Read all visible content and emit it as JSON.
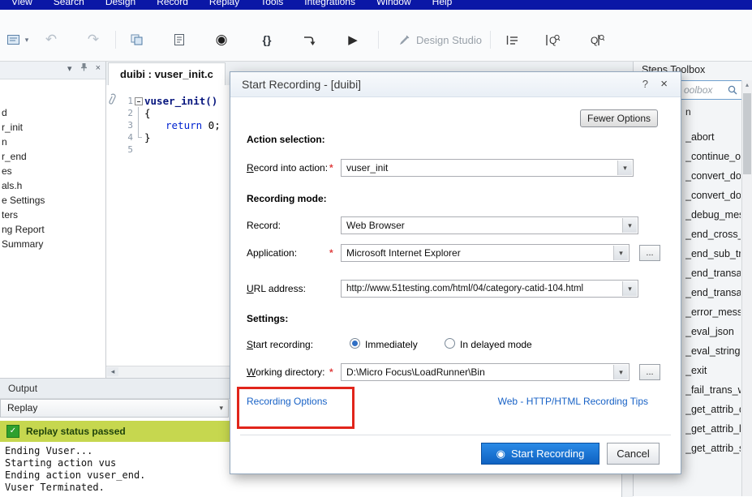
{
  "colors": {
    "menubar": "#0a17a6",
    "accent_blue": "#1173d2",
    "status_green_bg": "#c6d74f",
    "link_blue": "#1862c6",
    "annotation_red": "#e1251b"
  },
  "icons": {
    "caret_down": "▾",
    "undo": "↶",
    "redo": "↷",
    "record": "◉",
    "braces": "{}",
    "play": "▶",
    "close": "×",
    "check": "✓",
    "scroll_up": "▴",
    "scroll_left": "◂"
  },
  "menubar": {
    "items": [
      "View",
      "Search",
      "Design",
      "Record",
      "Replay",
      "Tools",
      "Integrations",
      "Window",
      "Help"
    ]
  },
  "toolbar": {
    "design_studio_label": "Design Studio"
  },
  "solution_panel": {
    "items": [
      "d",
      "r_init",
      "n",
      "r_end",
      "es",
      "als.h",
      "e Settings",
      "ters",
      "ng Report",
      "Summary"
    ]
  },
  "editor": {
    "tab_title": "duibi : vuser_init.c",
    "line_numbers": [
      "1",
      "2",
      "3",
      "4",
      "5"
    ],
    "code": {
      "line1": "vuser_init()",
      "line2": "{",
      "line3_keyword": "return",
      "line3_rest": " 0;",
      "line4": "}"
    }
  },
  "output": {
    "title": "Output",
    "filter_value": "Replay",
    "status_text": "Replay status passed",
    "console_lines": [
      "Ending Vuser...",
      "Starting action vus",
      "Ending action vuser_end.",
      "Vuser Terminated."
    ]
  },
  "steps_toolbox": {
    "title": "Steps Toolbox",
    "search_text": "oolbox",
    "category_label": "n",
    "items": [
      "_abort",
      "_continue_on_e",
      "_convert_doubl",
      "_convert_double",
      "_debug_messag",
      "_end_cross_vus",
      "_end_sub_trans",
      "_end_transactio",
      "_end_transactio",
      "_error_message",
      "_eval_json",
      "_eval_string",
      "_exit",
      "_fail_trans_with",
      "_get_attrib_dou",
      "_get_attrib_long",
      "_get_attrib_strin"
    ]
  },
  "dialog": {
    "title": "Start Recording - [duibi]",
    "help_glyph": "?",
    "close_glyph": "×",
    "fewer_options": "Fewer Options",
    "section_action": "Action selection:",
    "section_mode": "Recording mode:",
    "section_settings": "Settings:",
    "record_into_action": {
      "mnemonic": "R",
      "label_rest": "ecord into action:",
      "required": "*",
      "value": "vuser_init"
    },
    "record": {
      "label": "Record:",
      "value": "Web Browser"
    },
    "application": {
      "label": "Application:",
      "required": "*",
      "value": "Microsoft Internet Explorer",
      "browse": "..."
    },
    "url": {
      "mnemonic": "U",
      "label_rest": "RL address:",
      "value": "http://www.51testing.com/html/04/category-catid-104.html"
    },
    "start_recording": {
      "mnemonic": "S",
      "label_rest": "tart recording:",
      "option_immediately": "Immediately",
      "option_delayed": "In delayed mode"
    },
    "working_directory": {
      "mnemonic": "W",
      "label_rest": "orking directory:",
      "required": "*",
      "value": "D:\\Micro Focus\\LoadRunner\\Bin",
      "browse": "..."
    },
    "recording_options_link": "Recording Options",
    "tips_link": "Web - HTTP/HTML Recording Tips",
    "start_button": "Start Recording",
    "cancel_button": "Cancel"
  }
}
